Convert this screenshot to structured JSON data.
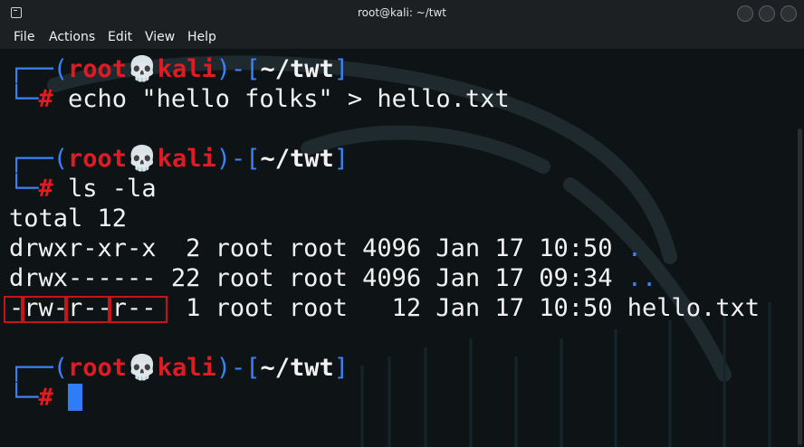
{
  "window": {
    "title": "root@kali: ~/twt"
  },
  "menu": {
    "items": [
      "File",
      "Actions",
      "Edit",
      "View",
      "Help"
    ]
  },
  "prompt": {
    "open": "┌──(",
    "user": "root",
    "skull": "💀",
    "host": "kali",
    "mid": ")-[",
    "dir": "~/twt",
    "close": "]",
    "cont": "└─",
    "hash": "#"
  },
  "commands": {
    "first": " echo \"hello folks\" > hello.txt",
    "second": " ls -la"
  },
  "output": {
    "total": "total 12",
    "rows": [
      {
        "perm": "drwxr-xr-x",
        "rest": "  2 root root 4096 Jan 17 10:50 ",
        "name": "."
      },
      {
        "perm": "drwx------",
        "rest": " 22 root root 4096 Jan 17 09:34 ",
        "name": ".."
      },
      {
        "perm": "-rw-r--r--",
        "rest": "  1 root root   12 Jan 17 10:50 ",
        "name": "hello.txt"
      }
    ]
  },
  "colors": {
    "prompt_blue": "#3b82f6",
    "prompt_red": "#e01b24",
    "highlight_box": "#c81414"
  }
}
